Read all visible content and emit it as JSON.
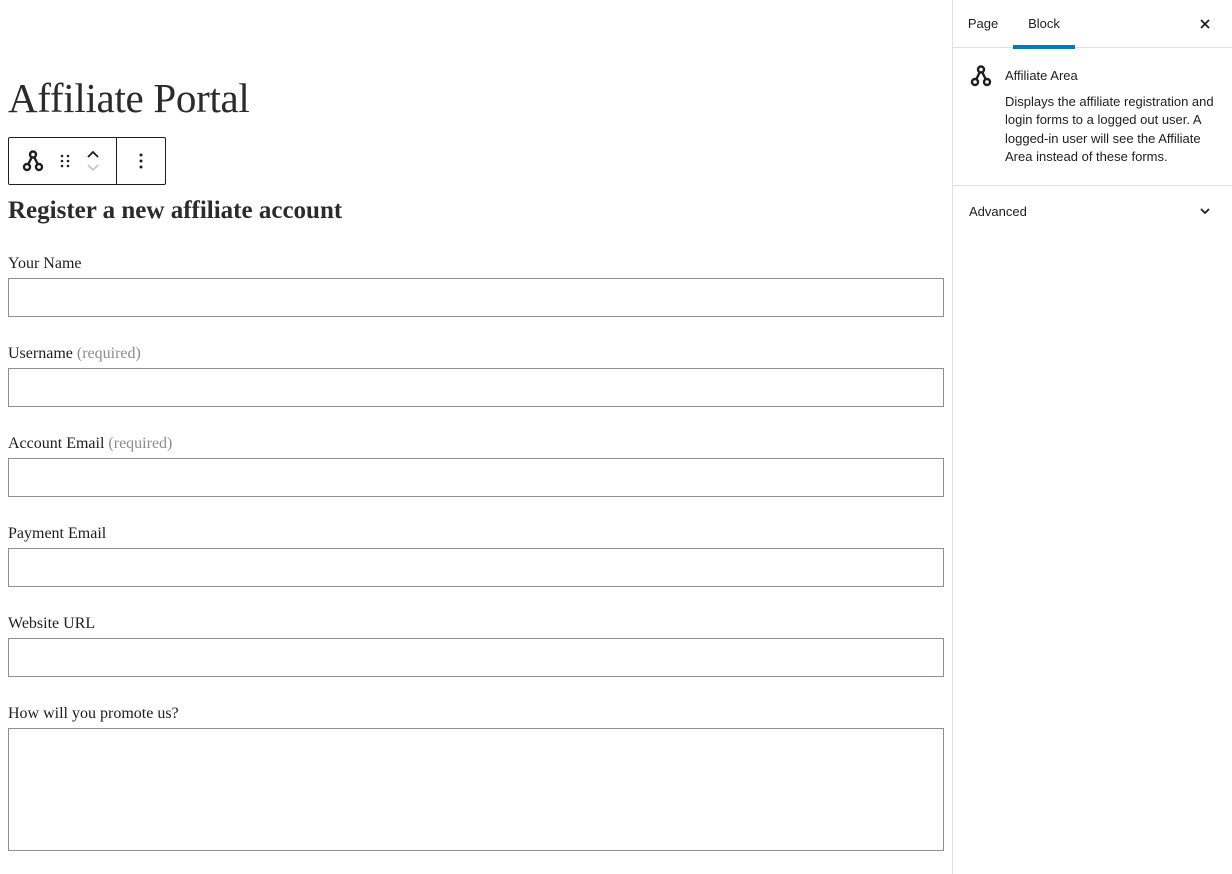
{
  "editor": {
    "page_title": "Affiliate Portal",
    "form_heading": "Register a new affiliate account",
    "required_marker": "(required)",
    "fields": {
      "name": {
        "label": "Your Name",
        "value": ""
      },
      "username": {
        "label": "Username",
        "value": ""
      },
      "account_email": {
        "label": "Account Email",
        "value": ""
      },
      "payment_email": {
        "label": "Payment Email",
        "value": ""
      },
      "website": {
        "label": "Website URL",
        "value": ""
      },
      "promote": {
        "label": "How will you promote us?",
        "value": ""
      }
    },
    "toolbar": {
      "block_icon": "affiliate-area-icon",
      "drag_icon": "drag-handle-icon",
      "move_up_icon": "chevron-up-icon",
      "move_down_icon": "chevron-down-icon",
      "options_icon": "more-vertical-icon"
    }
  },
  "sidebar": {
    "tabs": [
      {
        "label": "Page",
        "active": false
      },
      {
        "label": "Block",
        "active": true
      }
    ],
    "close_icon": "close-icon",
    "block_card": {
      "icon": "affiliate-area-icon",
      "title": "Affiliate Area",
      "description": "Displays the affiliate registration and login forms to a logged out user. A logged-in user will see the Affiliate Area instead of these forms."
    },
    "advanced_panel": {
      "title": "Advanced",
      "expanded": false,
      "icon": "chevron-down-icon"
    }
  },
  "colors": {
    "accent": "#007cba",
    "border": "#e0e0e0",
    "input_border": "#8c8f94",
    "muted_text": "#8c8c8c",
    "text": "#1e1e1e"
  }
}
